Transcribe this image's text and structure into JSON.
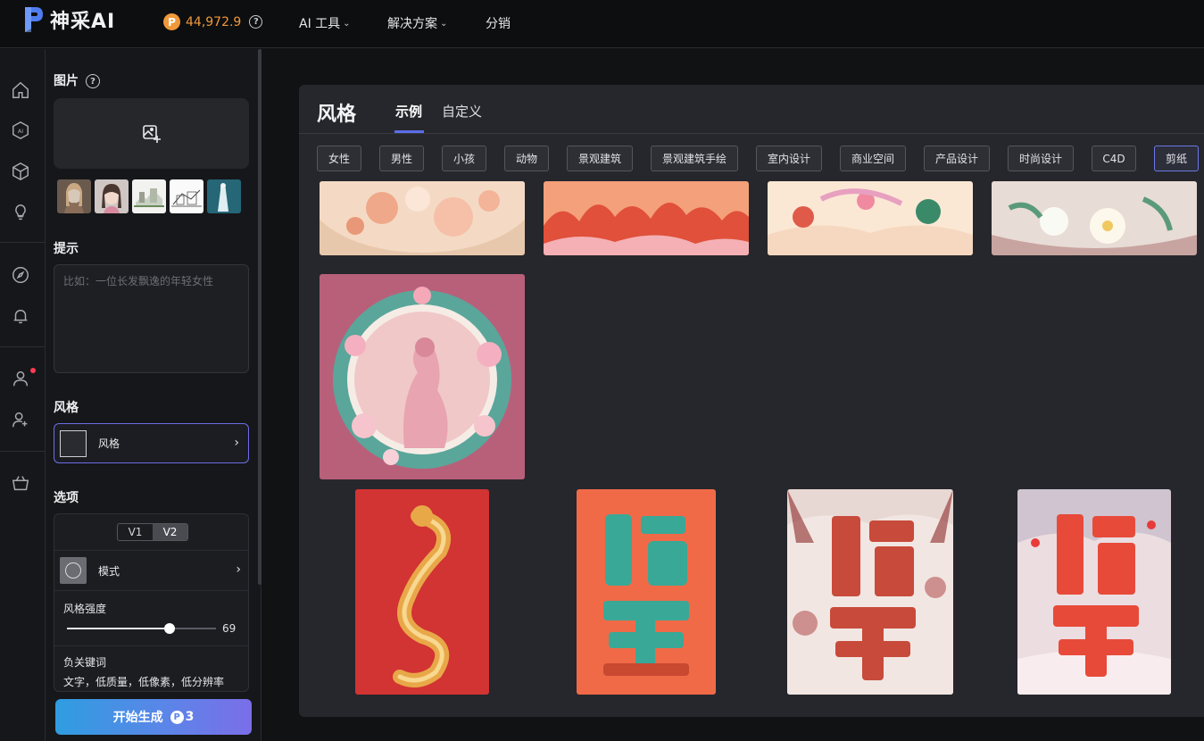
{
  "header": {
    "brand": "神采AI",
    "credits": "44,972.9",
    "coin_glyph": "P",
    "help_glyph": "?",
    "nav": [
      {
        "label": "AI 工具",
        "has_dropdown": true
      },
      {
        "label": "解决方案",
        "has_dropdown": true
      },
      {
        "label": "分销",
        "has_dropdown": false
      }
    ]
  },
  "rail": {
    "icons": [
      "home-icon",
      "ai-icon",
      "cube-icon",
      "lightbulb-icon",
      "compass-icon",
      "bell-icon",
      "user-icon",
      "user-add-icon",
      "basket-icon"
    ]
  },
  "panel": {
    "image_section": {
      "title": "图片",
      "help_glyph": "?"
    },
    "prompt_section": {
      "title": "提示",
      "placeholder": "比如：一位长发飘逸的年轻女性"
    },
    "style_section": {
      "title": "风格",
      "selected_label": "风格"
    },
    "options_section": {
      "title": "选项",
      "versions": [
        "V1",
        "V2"
      ],
      "active_version": "V2",
      "model_label": "模式",
      "strength_label": "风格强度",
      "strength_value": 69,
      "strength_max": 100,
      "negative_label": "负关键词",
      "negative_value": "文字，低质量，低像素，低分辨率"
    },
    "generate": {
      "label": "开始生成",
      "coin_glyph": "P",
      "cost": "3"
    }
  },
  "modal": {
    "title": "风格",
    "tabs": [
      "示例",
      "自定义"
    ],
    "active_tab": "示例",
    "categories": [
      "女性",
      "男性",
      "小孩",
      "动物",
      "景观建筑",
      "景观建筑手绘",
      "室内设计",
      "商业空间",
      "产品设计",
      "时尚设计",
      "C4D",
      "剪纸"
    ],
    "active_category": "剪纸"
  },
  "colors": {
    "accent": "#5b6dea",
    "credit": "#f0993a",
    "notification": "#ff3b52"
  }
}
